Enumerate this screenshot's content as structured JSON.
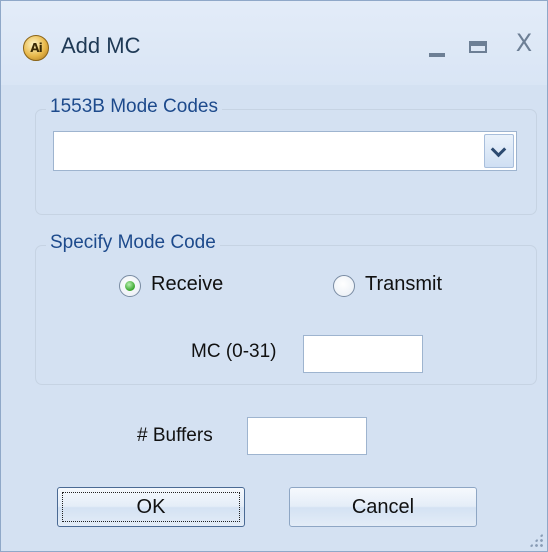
{
  "window": {
    "title": "Add MC",
    "icon_text": "Ai",
    "controls": {
      "minimize": "minimize",
      "maximize": "maximize",
      "close": "X"
    }
  },
  "mode_codes_group": {
    "legend": "1553B Mode Codes",
    "combo_value": ""
  },
  "specify_group": {
    "legend": "Specify Mode Code",
    "receive_label": "Receive",
    "transmit_label": "Transmit",
    "selected": "Receive",
    "mc_label": "MC (0-31)",
    "mc_value": ""
  },
  "buffers": {
    "label": "# Buffers",
    "value": ""
  },
  "buttons": {
    "ok": "OK",
    "cancel": "Cancel"
  },
  "colors": {
    "dialog_background": "#d4e1f2",
    "legend_text": "#1d4a8c",
    "radio_checked": "#37a52a"
  }
}
